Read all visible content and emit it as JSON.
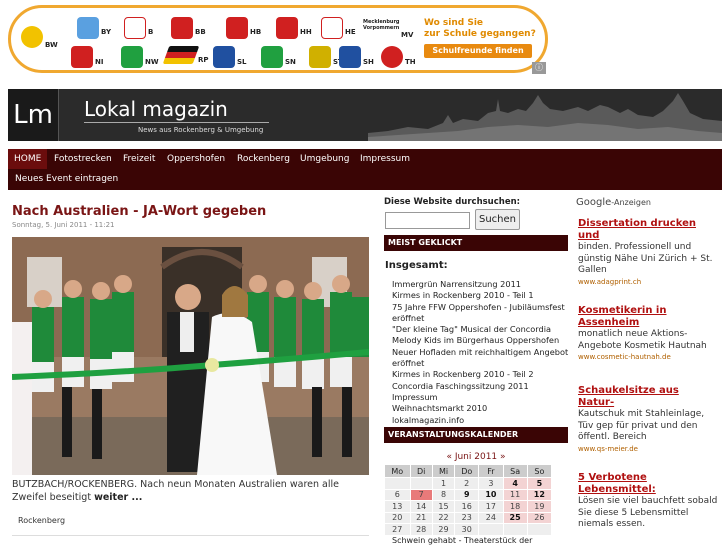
{
  "banner": {
    "states": [
      {
        "code": "BW",
        "color": "#f2c200"
      },
      {
        "code": "BY",
        "color": "#5aa0e0"
      },
      {
        "code": "B",
        "color": "#d02020"
      },
      {
        "code": "BB",
        "color": "#d02020"
      },
      {
        "code": "HB",
        "color": "#d02020"
      },
      {
        "code": "HH",
        "color": "#d02020"
      },
      {
        "code": "HE",
        "color": "#d02020"
      },
      {
        "code": "MV",
        "color": "#2060b0"
      },
      {
        "code": "NI",
        "color": "#d02020"
      },
      {
        "code": "NW",
        "color": "#20a040"
      },
      {
        "code": "RP",
        "color": "#d08020"
      },
      {
        "code": "SL",
        "color": "#2050a0"
      },
      {
        "code": "SN",
        "color": "#20a040"
      },
      {
        "code": "ST",
        "color": "#d0b000"
      },
      {
        "code": "SH",
        "color": "#2050a0"
      },
      {
        "code": "TH",
        "color": "#d02020"
      }
    ],
    "mv_label": "Mecklenburg Vorpommern",
    "question_line1": "Wo sind Sie",
    "question_line2": "zur Schule gegangen?",
    "button": "Schulfreunde finden"
  },
  "header": {
    "logo": "Lm",
    "title": "Lokal magazin",
    "subtitle": "News aus Rockenberg & Umgebung"
  },
  "nav": {
    "items": [
      "HOME",
      "Fotostrecken",
      "Freizeit",
      "Oppershofen",
      "Rockenberg",
      "Umgebung",
      "Impressum"
    ],
    "second_row": "Neues Event eintragen"
  },
  "article": {
    "title": "Nach Australien - JA-Wort gegeben",
    "date": "Sonntag, 5. Juni 2011 - 11:21",
    "text": "BUTZBACH/ROCKENBERG. Nach neun Monaten Australien waren alle Zweifel beseitigt",
    "more": "weiter ...",
    "tag": "Rockenberg"
  },
  "search": {
    "label": "Diese Website durchsuchen:",
    "value": "",
    "button": "Suchen"
  },
  "most_clicked": {
    "heading": "MEIST GEKLICKT",
    "subheading": "Insgesamt:",
    "items": [
      "Immergrün Narrensitzung 2011",
      "Kirmes in Rockenberg 2010 - Teil 1",
      "75 Jahre FFW Oppershofen - Jubiläumsfest eröffnet",
      "\"Der kleine Tag\" Musical der Concordia",
      "Melody Kids im Bürgerhaus Oppershofen",
      "Neuer Hofladen mit reichhaltigem Angebot eröffnet",
      "Kirmes in Rockenberg 2010 - Teil 2",
      "Concordia Faschingssitzung 2011",
      "Impressum",
      "Weihnachtsmarkt 2010",
      "lokalmagazin.info"
    ]
  },
  "calendar": {
    "heading": "VERANSTALTUNGSKALENDER",
    "prev": "«",
    "month": "Juni 2011",
    "next": "»",
    "weekdays": [
      "Mo",
      "Di",
      "Mi",
      "Do",
      "Fr",
      "Sa",
      "So"
    ],
    "weeks": [
      [
        "",
        "",
        "1",
        "2",
        "3",
        "4",
        "5"
      ],
      [
        "6",
        "7",
        "8",
        "9",
        "10",
        "11",
        "12"
      ],
      [
        "13",
        "14",
        "15",
        "16",
        "17",
        "18",
        "19"
      ],
      [
        "20",
        "21",
        "22",
        "23",
        "24",
        "25",
        "26"
      ],
      [
        "27",
        "28",
        "29",
        "30",
        "",
        "",
        ""
      ]
    ],
    "bold_days": [
      "4",
      "5",
      "9",
      "10",
      "12",
      "25"
    ],
    "today": "7",
    "event_line": "Schwein gehabt - Theaterstück der"
  },
  "ads": {
    "label_brand": "Google",
    "label_suffix": "-Anzeigen",
    "items": [
      {
        "title": "Dissertation drucken und",
        "text": "binden. Professionell und günstig Nähe Uni Zürich + St. Gallen",
        "url": "www.adagprint.ch"
      },
      {
        "title": "Kosmetikerin in Assenheim",
        "text": "monatlich neue Aktions-Angebote Kosmetik Hautnah",
        "url": "www.cosmetic-hautnah.de"
      },
      {
        "title": "Schaukelsitze aus Natur-",
        "text": "Kautschuk mit Stahleinlage, Tüv gep für privat und den öffentl. Bereich",
        "url": "www.qs-meier.de"
      },
      {
        "title": "5 Verbotene Lebensmittel:",
        "text": "Lösen sie viel bauchfett sobald Sie diese 5 Lebensmittel niemals essen.",
        "url": ""
      }
    ]
  }
}
